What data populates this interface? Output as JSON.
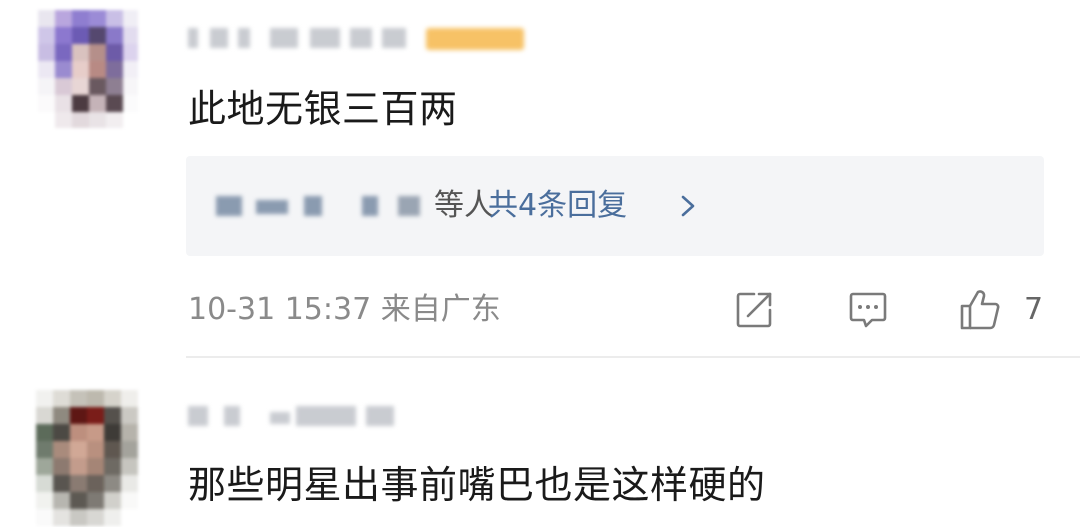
{
  "comments": [
    {
      "text": "此地无银三百两",
      "reply_summary": {
        "replier_suffix": "等人",
        "count_label": "共4条回复"
      },
      "time": "10-31 15:37",
      "location": "来自广东",
      "like_count": "7",
      "icons": {
        "forward": "forward-icon",
        "reply": "comment-icon",
        "like": "thumbs-up-icon"
      }
    },
    {
      "text": "那些明星出事前嘴巴也是这样硬的"
    }
  ],
  "colors": {
    "reply_link": "#4a6e9c",
    "meta_text": "#8a8a8a",
    "reply_box_bg": "#f4f5f7",
    "vip_badge": "#f7c266"
  }
}
